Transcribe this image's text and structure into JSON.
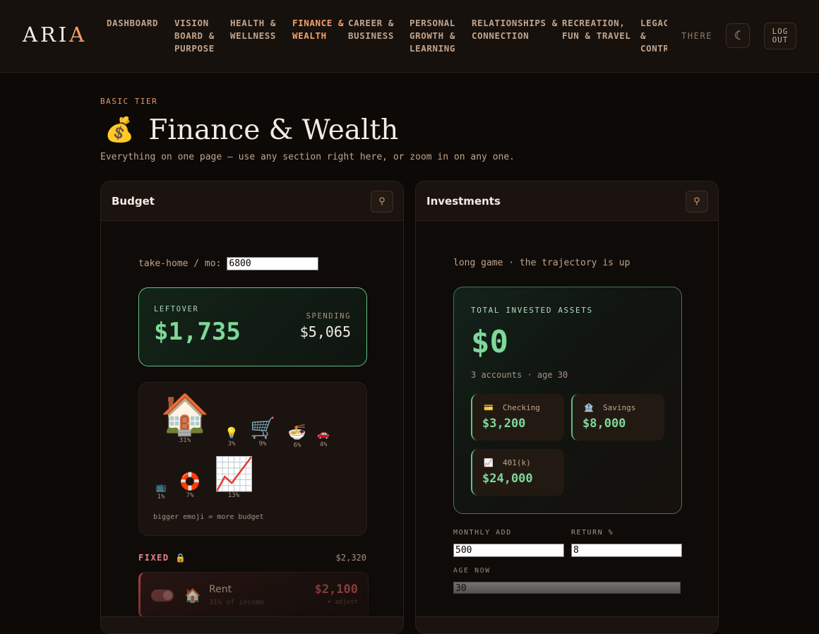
{
  "header": {
    "logo_main": "ARI",
    "logo_accent": "A",
    "nav": [
      {
        "label": "DASHBOARD",
        "width": 96,
        "active": false
      },
      {
        "label": "VISION BOARD & PURPOSE",
        "width": 79,
        "active": false
      },
      {
        "label": "HEALTH & WELLNESS",
        "width": 88,
        "active": false
      },
      {
        "label": "FINANCE & WEALTH",
        "width": 79,
        "active": true
      },
      {
        "label": "CAREER & BUSINESS",
        "width": 87,
        "active": false
      },
      {
        "label": "PERSONAL GROWTH & LEARNING",
        "width": 88,
        "active": false
      },
      {
        "label": "RELATIONSHIPS & CONNECTION",
        "width": 128,
        "active": false
      },
      {
        "label": "RECREATION, FUN & TRAVEL",
        "width": 111,
        "active": false
      },
      {
        "label": "LEGACY & CONTRIBUTION",
        "width": 60,
        "active": false
      }
    ],
    "user": "THERE",
    "theme_icon": "☾",
    "logout": "LOG OUT"
  },
  "page": {
    "tier": "BASIC TIER",
    "emoji": "💰",
    "title": "Finance & Wealth",
    "subtitle": "Everything on one page — use any section right here, or zoom in on any one."
  },
  "budget": {
    "title": "Budget",
    "pin_icon": "⚲",
    "takehome_label": "take-home / mo:",
    "takehome_value": "6800",
    "leftover_label": "LEFTOVER",
    "leftover_value": "$1,735",
    "spending_label": "SPENDING",
    "spending_value": "$5,065",
    "emojis": [
      {
        "glyph": "🏠",
        "pct": "31%"
      },
      {
        "glyph": "💡",
        "pct": "3%"
      },
      {
        "glyph": "🛒",
        "pct": "9%"
      },
      {
        "glyph": "🍜",
        "pct": "6%"
      },
      {
        "glyph": "🚗",
        "pct": "4%"
      },
      {
        "glyph": "📺",
        "pct": "1%"
      },
      {
        "glyph": "🛟",
        "pct": "7%"
      },
      {
        "glyph": "📈",
        "pct": "13%"
      }
    ],
    "emoji_note": "bigger emoji = more budget",
    "fixed_label": "FIXED 🔒",
    "fixed_total": "$2,320",
    "rent": {
      "icon": "🏠",
      "name": "Rent",
      "sub": "31% of income",
      "amount": "$2,100",
      "adjust": "▾ adjust"
    }
  },
  "investments": {
    "title": "Investments",
    "pin_icon": "⚲",
    "tagline": "long game · the trajectory is up",
    "total_label": "TOTAL INVESTED ASSETS",
    "total_value": "$0",
    "sub": "3 accounts · age 30",
    "accounts": [
      {
        "icon": "💳",
        "name": "Checking",
        "value": "$3,200"
      },
      {
        "icon": "🏦",
        "name": "Savings",
        "value": "$8,000"
      },
      {
        "icon": "📈",
        "name": "401(k)",
        "value": "$24,000"
      }
    ],
    "monthly_add_label": "MONTHLY ADD",
    "monthly_add_value": "500",
    "return_label": "RETURN %",
    "return_value": "8",
    "age_label": "AGE NOW",
    "age_value": "30"
  }
}
